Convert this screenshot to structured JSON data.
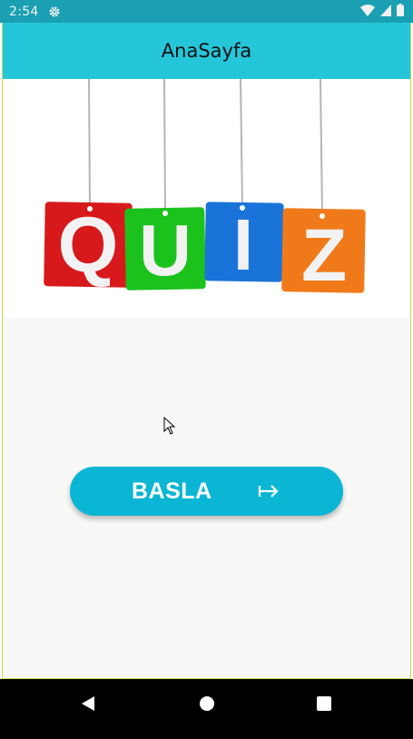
{
  "status_bar": {
    "time": "2:54",
    "icons": [
      "gear-icon",
      "wifi-icon",
      "signal-icon",
      "battery-icon"
    ]
  },
  "app_bar": {
    "title": "AnaSayfa"
  },
  "quiz_image": {
    "letters": [
      "Q",
      "U",
      "I",
      "Z"
    ],
    "colors": [
      "#d7191c",
      "#1cc21c",
      "#1a73d9",
      "#f07a1a"
    ]
  },
  "main": {
    "start_button_label": "BASLA",
    "start_button_icon": "arrow-right-icon"
  },
  "nav_bar": {
    "icons": [
      "back-icon",
      "home-icon",
      "recent-apps-icon"
    ]
  },
  "colors": {
    "status_bar": "#1a9fb3",
    "app_bar": "#26c6da",
    "button": "#0ab6d4",
    "background": "#f8f8f6"
  }
}
